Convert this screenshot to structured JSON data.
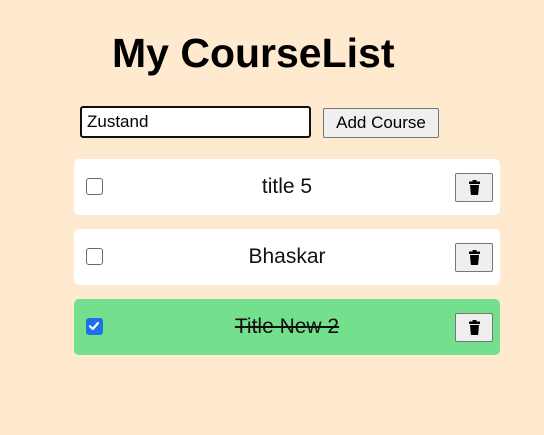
{
  "header": {
    "title": "My CourseList"
  },
  "form": {
    "input_value": "Zustand",
    "add_label": "Add Course"
  },
  "courses": [
    {
      "title": "title 5",
      "completed": false,
      "delete_icon": "trash-icon"
    },
    {
      "title": "Bhaskar",
      "completed": false,
      "delete_icon": "trash-icon"
    },
    {
      "title": "Title New 2",
      "completed": true,
      "delete_icon": "trash-icon"
    }
  ],
  "colors": {
    "background": "#ffead0",
    "card": "#ffffff",
    "completed_card": "#74e08e",
    "checkbox_checked": "#1f6feb"
  }
}
